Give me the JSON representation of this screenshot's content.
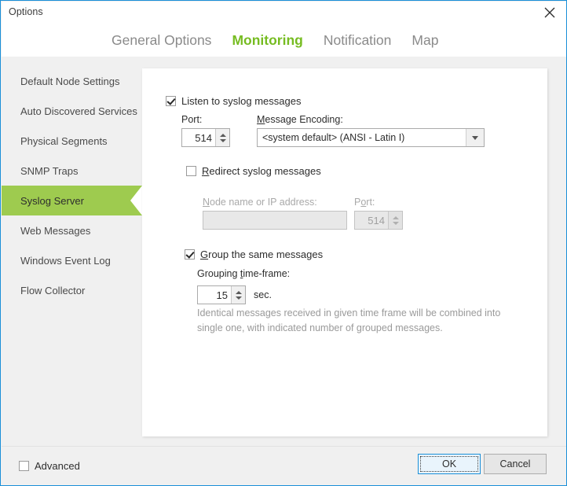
{
  "window": {
    "title": "Options",
    "close_icon": "close-icon"
  },
  "tabs": [
    {
      "label": "General Options",
      "active": false
    },
    {
      "label": "Monitoring",
      "active": true
    },
    {
      "label": "Notification",
      "active": false
    },
    {
      "label": "Map",
      "active": false
    }
  ],
  "sidebar": {
    "items": [
      {
        "label": "Default Node Settings",
        "selected": false
      },
      {
        "label": "Auto Discovered Services",
        "selected": false
      },
      {
        "label": "Physical Segments",
        "selected": false
      },
      {
        "label": "SNMP Traps",
        "selected": false
      },
      {
        "label": "Syslog Server",
        "selected": true
      },
      {
        "label": "Web Messages",
        "selected": false
      },
      {
        "label": "Windows Event Log",
        "selected": false
      },
      {
        "label": "Flow Collector",
        "selected": false
      }
    ]
  },
  "panel": {
    "listen": {
      "label": "Listen to syslog messages",
      "checked": true
    },
    "port": {
      "label": "Port:",
      "value": "514"
    },
    "encoding": {
      "label": "Message Encoding:",
      "label_accel": "M",
      "label_rest": "essage Encoding:",
      "value": "<system default>  (ANSI - Latin I)",
      "arrow_icon": "chevron-down-icon"
    },
    "redirect": {
      "label_accel": "R",
      "label_rest": "edirect syslog messages",
      "checked": false,
      "node_label_accel": "N",
      "node_label_rest": "ode name or IP address:",
      "node_value": "",
      "node_placeholder": "",
      "port_label_accel": "P",
      "port_label_mid": "o",
      "port_label_rest": "rt:",
      "port_value": "514"
    },
    "group": {
      "label_accel": "G",
      "label_rest": "roup the same messages",
      "checked": true,
      "timeframe_label_pre": "Grouping ",
      "timeframe_label_accel": "t",
      "timeframe_label_rest": "ime-frame:",
      "timeframe_value": "15",
      "unit": "sec.",
      "description_line1": "Identical messages received in given time frame will be combined into",
      "description_line2": "single one, with indicated number of grouped messages."
    }
  },
  "footer": {
    "advanced_label": "Advanced",
    "advanced_checked": false,
    "ok_label": "OK",
    "cancel_label": "Cancel"
  },
  "colors": {
    "accent_green": "#76bc21",
    "sidebar_selected": "#9ecb4f",
    "window_border": "#1a8fd8"
  }
}
